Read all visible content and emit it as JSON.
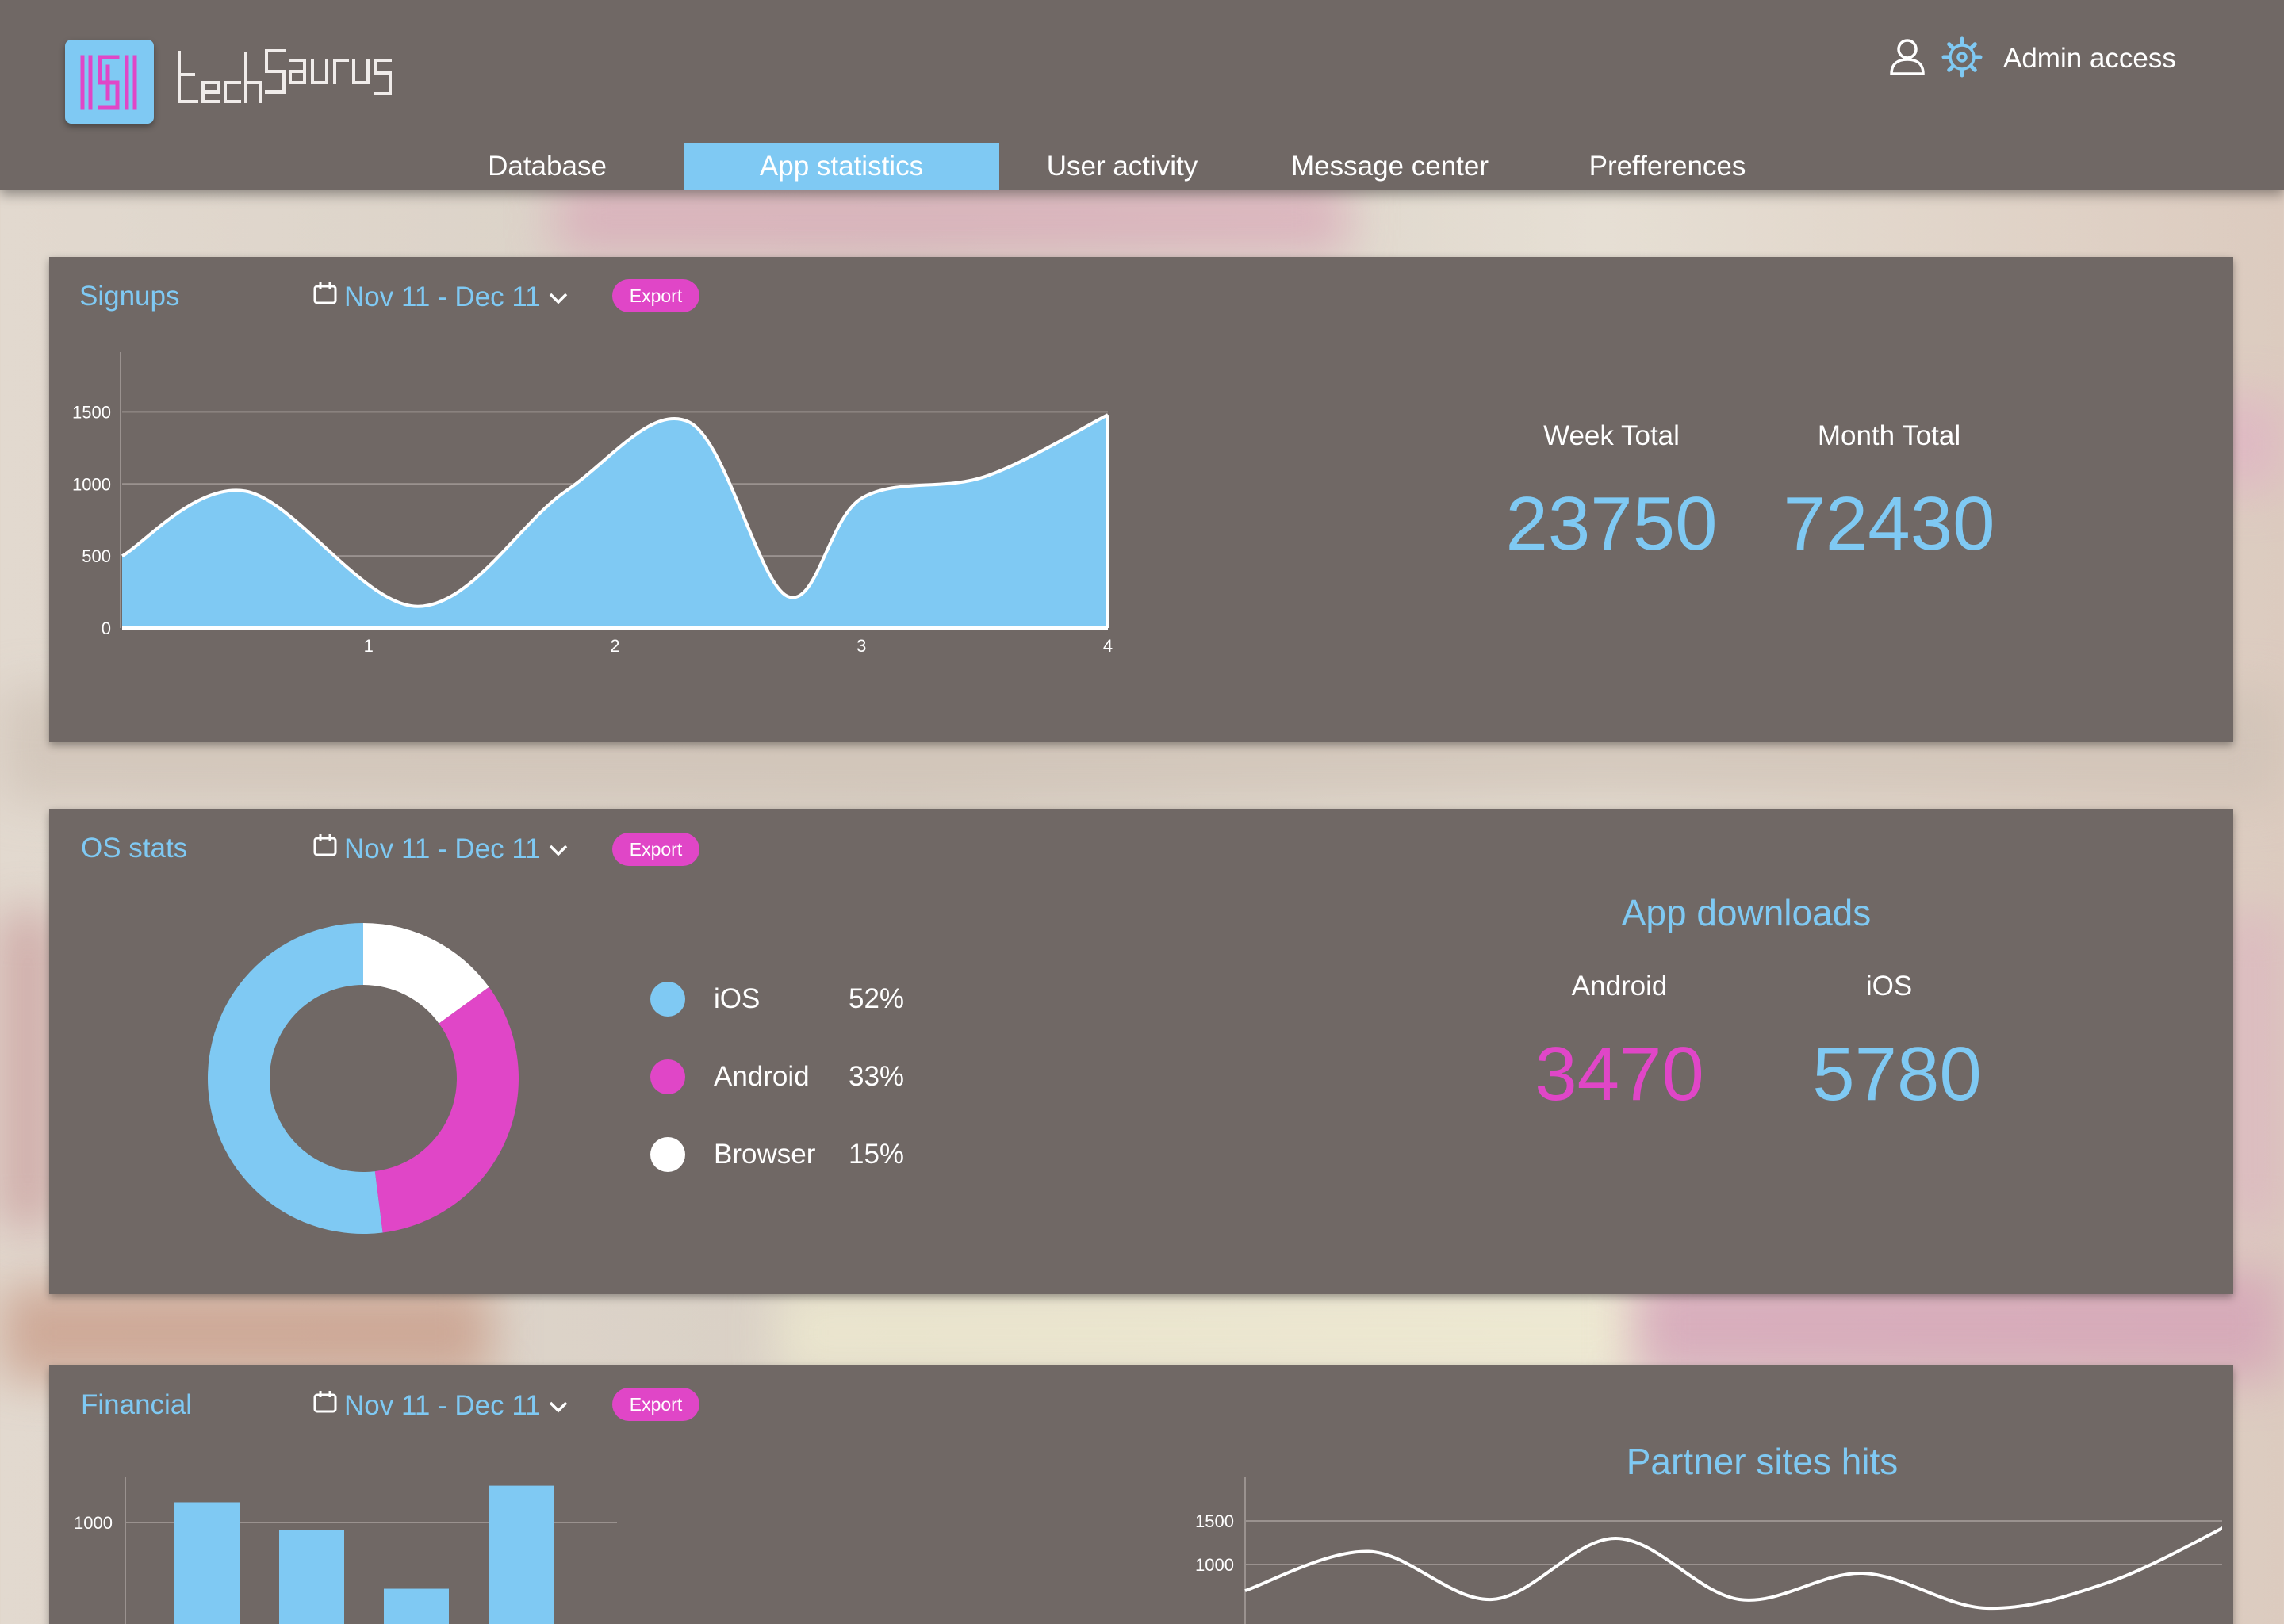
{
  "header": {
    "logo_text": "techSaurus",
    "admin_label": "Admin access",
    "nav": [
      {
        "label": "Database",
        "active": false
      },
      {
        "label": "App statistics",
        "active": true
      },
      {
        "label": "User activity",
        "active": false
      },
      {
        "label": "Message center",
        "active": false
      },
      {
        "label": "Prefferences",
        "active": false
      }
    ]
  },
  "colors": {
    "accent_blue": "#7fc9f3",
    "accent_pink": "#e046c7",
    "panel_bg": "#706865"
  },
  "signups": {
    "title": "Signups",
    "date_range": "Nov 11 - Dec 11",
    "export_label": "Export",
    "week_total_label": "Week Total",
    "week_total": "23750",
    "month_total_label": "Month Total",
    "month_total": "72430"
  },
  "os_stats": {
    "title": "OS stats",
    "date_range": "Nov 11 - Dec 11",
    "export_label": "Export",
    "legend": [
      {
        "label": "iOS",
        "pct": "52%",
        "color": "#7fc9f3"
      },
      {
        "label": "Android",
        "pct": "33%",
        "color": "#e046c7"
      },
      {
        "label": "Browser",
        "pct": "15%",
        "color": "#ffffff"
      }
    ],
    "downloads_title": "App downloads",
    "android_label": "Android",
    "android_value": "3470",
    "ios_label": "iOS",
    "ios_value": "5780"
  },
  "financial": {
    "title": "Financial",
    "date_range": "Nov 11 - Dec 11",
    "export_label": "Export",
    "partner_title": "Partner sites hits"
  },
  "chart_data": [
    {
      "type": "area",
      "x": [
        0,
        0.5,
        1.2,
        1.8,
        2.3,
        2.7,
        3.0,
        3.5,
        4.0
      ],
      "y": [
        500,
        950,
        150,
        950,
        1430,
        220,
        900,
        1050,
        1480
      ],
      "xticks": [
        "1",
        "2",
        "3",
        "4"
      ],
      "yticks": [
        "0",
        "500",
        "1000",
        "1500"
      ],
      "ylim": [
        0,
        1750
      ],
      "xlim": [
        0,
        4
      ],
      "grid": true
    },
    {
      "type": "pie",
      "labels": [
        "iOS",
        "Android",
        "Browser"
      ],
      "values": [
        52,
        33,
        15
      ]
    },
    {
      "type": "bar",
      "categories": [
        "",
        "",
        "",
        ""
      ],
      "values": [
        1110,
        960,
        640,
        1200
      ],
      "yticks": [
        "1000"
      ],
      "grid": true
    },
    {
      "type": "line",
      "title": "Partner sites hits",
      "x": [
        0,
        0.5,
        1.0,
        1.5,
        2.0,
        2.5,
        3.0,
        3.5,
        4.0
      ],
      "y": [
        700,
        1150,
        600,
        1300,
        600,
        900,
        500,
        800,
        1480
      ],
      "yticks": [
        "1500",
        "1000"
      ],
      "grid": true
    }
  ]
}
